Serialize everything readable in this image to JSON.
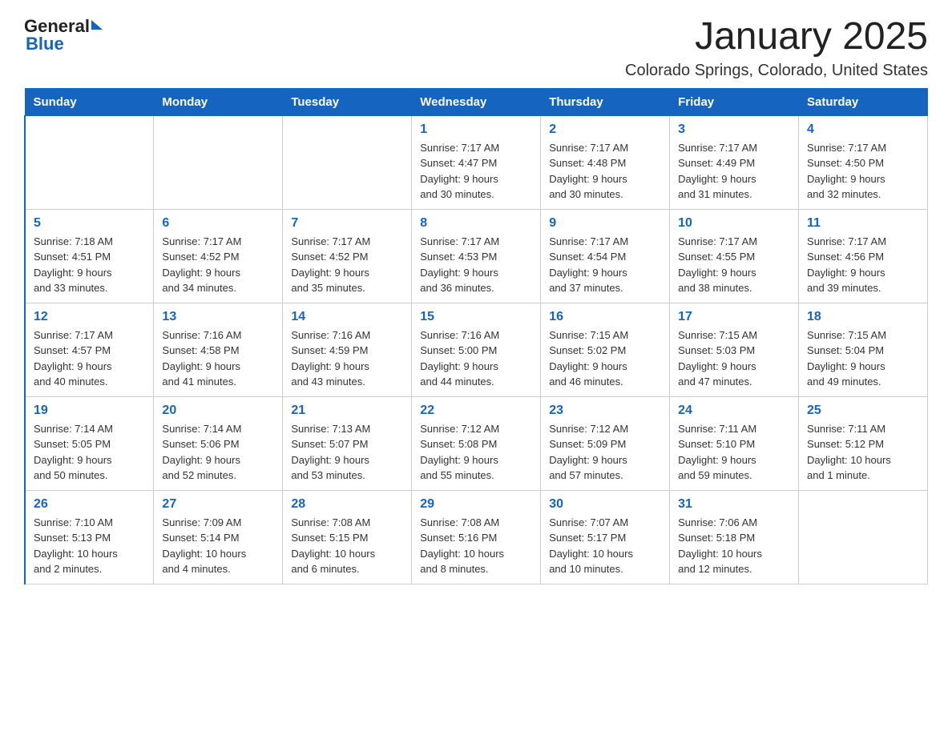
{
  "logo": {
    "text_general": "General",
    "arrow": "▶",
    "text_blue": "Blue"
  },
  "title": "January 2025",
  "subtitle": "Colorado Springs, Colorado, United States",
  "calendar": {
    "headers": [
      "Sunday",
      "Monday",
      "Tuesday",
      "Wednesday",
      "Thursday",
      "Friday",
      "Saturday"
    ],
    "weeks": [
      [
        {
          "day": "",
          "info": ""
        },
        {
          "day": "",
          "info": ""
        },
        {
          "day": "",
          "info": ""
        },
        {
          "day": "1",
          "info": "Sunrise: 7:17 AM\nSunset: 4:47 PM\nDaylight: 9 hours\nand 30 minutes."
        },
        {
          "day": "2",
          "info": "Sunrise: 7:17 AM\nSunset: 4:48 PM\nDaylight: 9 hours\nand 30 minutes."
        },
        {
          "day": "3",
          "info": "Sunrise: 7:17 AM\nSunset: 4:49 PM\nDaylight: 9 hours\nand 31 minutes."
        },
        {
          "day": "4",
          "info": "Sunrise: 7:17 AM\nSunset: 4:50 PM\nDaylight: 9 hours\nand 32 minutes."
        }
      ],
      [
        {
          "day": "5",
          "info": "Sunrise: 7:18 AM\nSunset: 4:51 PM\nDaylight: 9 hours\nand 33 minutes."
        },
        {
          "day": "6",
          "info": "Sunrise: 7:17 AM\nSunset: 4:52 PM\nDaylight: 9 hours\nand 34 minutes."
        },
        {
          "day": "7",
          "info": "Sunrise: 7:17 AM\nSunset: 4:52 PM\nDaylight: 9 hours\nand 35 minutes."
        },
        {
          "day": "8",
          "info": "Sunrise: 7:17 AM\nSunset: 4:53 PM\nDaylight: 9 hours\nand 36 minutes."
        },
        {
          "day": "9",
          "info": "Sunrise: 7:17 AM\nSunset: 4:54 PM\nDaylight: 9 hours\nand 37 minutes."
        },
        {
          "day": "10",
          "info": "Sunrise: 7:17 AM\nSunset: 4:55 PM\nDaylight: 9 hours\nand 38 minutes."
        },
        {
          "day": "11",
          "info": "Sunrise: 7:17 AM\nSunset: 4:56 PM\nDaylight: 9 hours\nand 39 minutes."
        }
      ],
      [
        {
          "day": "12",
          "info": "Sunrise: 7:17 AM\nSunset: 4:57 PM\nDaylight: 9 hours\nand 40 minutes."
        },
        {
          "day": "13",
          "info": "Sunrise: 7:16 AM\nSunset: 4:58 PM\nDaylight: 9 hours\nand 41 minutes."
        },
        {
          "day": "14",
          "info": "Sunrise: 7:16 AM\nSunset: 4:59 PM\nDaylight: 9 hours\nand 43 minutes."
        },
        {
          "day": "15",
          "info": "Sunrise: 7:16 AM\nSunset: 5:00 PM\nDaylight: 9 hours\nand 44 minutes."
        },
        {
          "day": "16",
          "info": "Sunrise: 7:15 AM\nSunset: 5:02 PM\nDaylight: 9 hours\nand 46 minutes."
        },
        {
          "day": "17",
          "info": "Sunrise: 7:15 AM\nSunset: 5:03 PM\nDaylight: 9 hours\nand 47 minutes."
        },
        {
          "day": "18",
          "info": "Sunrise: 7:15 AM\nSunset: 5:04 PM\nDaylight: 9 hours\nand 49 minutes."
        }
      ],
      [
        {
          "day": "19",
          "info": "Sunrise: 7:14 AM\nSunset: 5:05 PM\nDaylight: 9 hours\nand 50 minutes."
        },
        {
          "day": "20",
          "info": "Sunrise: 7:14 AM\nSunset: 5:06 PM\nDaylight: 9 hours\nand 52 minutes."
        },
        {
          "day": "21",
          "info": "Sunrise: 7:13 AM\nSunset: 5:07 PM\nDaylight: 9 hours\nand 53 minutes."
        },
        {
          "day": "22",
          "info": "Sunrise: 7:12 AM\nSunset: 5:08 PM\nDaylight: 9 hours\nand 55 minutes."
        },
        {
          "day": "23",
          "info": "Sunrise: 7:12 AM\nSunset: 5:09 PM\nDaylight: 9 hours\nand 57 minutes."
        },
        {
          "day": "24",
          "info": "Sunrise: 7:11 AM\nSunset: 5:10 PM\nDaylight: 9 hours\nand 59 minutes."
        },
        {
          "day": "25",
          "info": "Sunrise: 7:11 AM\nSunset: 5:12 PM\nDaylight: 10 hours\nand 1 minute."
        }
      ],
      [
        {
          "day": "26",
          "info": "Sunrise: 7:10 AM\nSunset: 5:13 PM\nDaylight: 10 hours\nand 2 minutes."
        },
        {
          "day": "27",
          "info": "Sunrise: 7:09 AM\nSunset: 5:14 PM\nDaylight: 10 hours\nand 4 minutes."
        },
        {
          "day": "28",
          "info": "Sunrise: 7:08 AM\nSunset: 5:15 PM\nDaylight: 10 hours\nand 6 minutes."
        },
        {
          "day": "29",
          "info": "Sunrise: 7:08 AM\nSunset: 5:16 PM\nDaylight: 10 hours\nand 8 minutes."
        },
        {
          "day": "30",
          "info": "Sunrise: 7:07 AM\nSunset: 5:17 PM\nDaylight: 10 hours\nand 10 minutes."
        },
        {
          "day": "31",
          "info": "Sunrise: 7:06 AM\nSunset: 5:18 PM\nDaylight: 10 hours\nand 12 minutes."
        },
        {
          "day": "",
          "info": ""
        }
      ]
    ]
  }
}
